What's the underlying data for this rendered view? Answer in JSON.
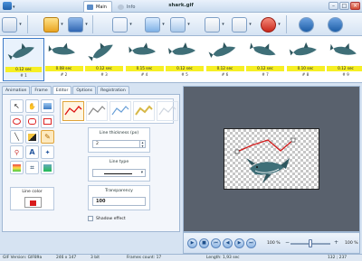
{
  "window": {
    "title": "shark.gif",
    "tabs": [
      {
        "label": "Main",
        "active": true
      },
      {
        "label": "Info",
        "active": false
      }
    ]
  },
  "frames": [
    {
      "delay": "0.12 sec",
      "number": "# 1",
      "selected": true
    },
    {
      "delay": "0.08 sec",
      "number": "# 2"
    },
    {
      "delay": "0.12 sec",
      "number": "# 3"
    },
    {
      "delay": "0.15 sec",
      "number": "# 4"
    },
    {
      "delay": "0.12 sec",
      "number": "# 5"
    },
    {
      "delay": "0.12 sec",
      "number": "# 6"
    },
    {
      "delay": "0.12 sec",
      "number": "# 7"
    },
    {
      "delay": "0.10 sec",
      "number": "# 8"
    },
    {
      "delay": "0.12 sec",
      "number": "# 9"
    }
  ],
  "left_tabs": [
    {
      "label": "Animation"
    },
    {
      "label": "Frame"
    },
    {
      "label": "Editor",
      "active": true
    },
    {
      "label": "Options"
    },
    {
      "label": "Registration"
    }
  ],
  "editor": {
    "line_color_label": "Line color",
    "line_color": "#d81b1b",
    "line_thickness_label": "Line thickness (px)",
    "line_thickness_value": "2",
    "line_type_label": "Line type",
    "transparency_label": "Transparency",
    "transparency_value": "100",
    "shadow_effect_label": "Shadow effect"
  },
  "player": {
    "zoom_left": "100 %",
    "zoom_right": "100 %"
  },
  "status": {
    "version": "GIF Version: GIF89a",
    "dimensions": "246 x 147",
    "bits": "3 bit",
    "frames": "Frames count: 17",
    "length": "Length: 1,93 sec",
    "coords": "132 ; 237"
  },
  "colors": {
    "accent": "#3d7bc8",
    "delay_bg": "#f6ef24",
    "canvas_bg": "#59616d"
  }
}
